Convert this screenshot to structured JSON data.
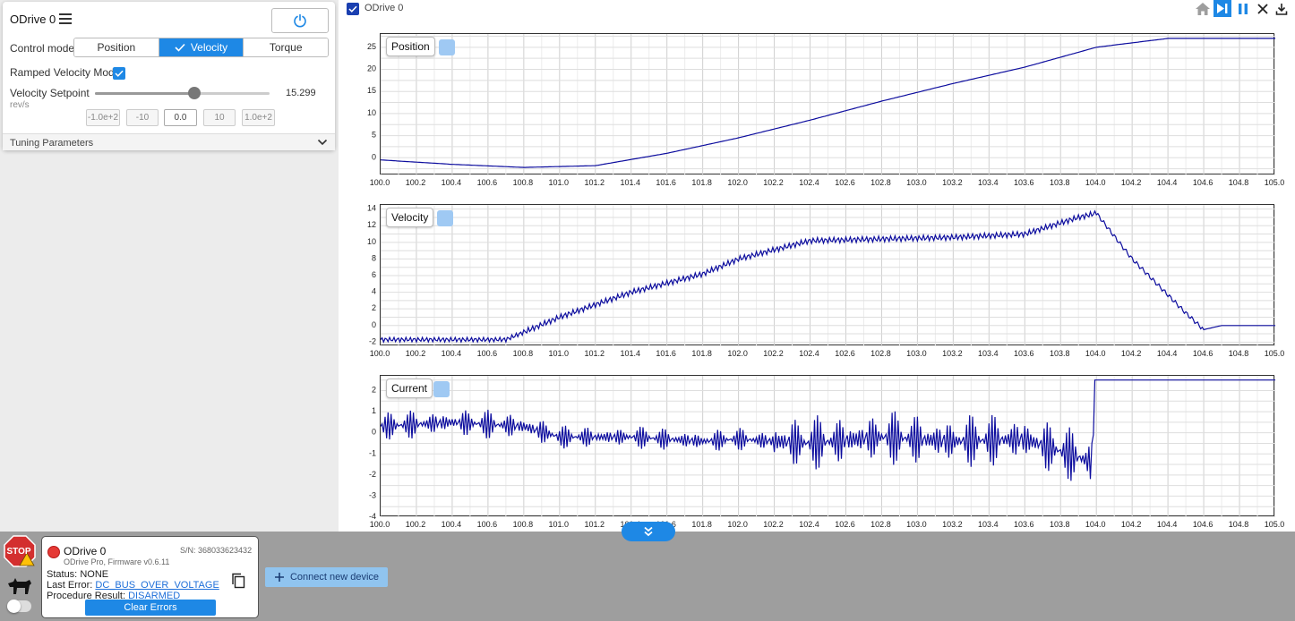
{
  "control_panel": {
    "title": "ODrive 0",
    "control_mode_label": "Control mode",
    "modes": [
      "Position",
      "Velocity",
      "Torque"
    ],
    "active_mode": "Velocity",
    "ramped_label": "Ramped Velocity Mode",
    "ramped_checked": true,
    "setpoint_label": "Velocity Setpoint",
    "setpoint_unit": "rev/s",
    "setpoint_value": "15.299",
    "slider_fraction": 0.57,
    "step_buttons": [
      "-1.0e+2",
      "-10",
      "0.0",
      "10",
      "1.0e+2"
    ],
    "tuning_label": "Tuning Parameters"
  },
  "plot": {
    "title": "ODrive 0",
    "toolbar_icons": [
      "home-icon",
      "skip-end-icon",
      "pause-icon",
      "close-icon",
      "download-icon"
    ],
    "line_color": "#0d0d9e"
  },
  "chart_data": [
    {
      "type": "line",
      "title": "Position",
      "x": [
        100.0,
        100.4,
        100.8,
        101.2,
        101.6,
        102.0,
        102.4,
        102.8,
        103.2,
        103.6,
        104.0,
        104.4,
        104.8,
        105.0
      ],
      "series": [
        {
          "values": [
            -0.5,
            -1.5,
            -2.2,
            -1.8,
            1.0,
            4.5,
            8.5,
            12.8,
            16.8,
            20.5,
            25.0,
            27.0,
            27.0,
            27.0
          ]
        }
      ],
      "xlim": [
        100.0,
        105.0
      ],
      "ylim": [
        -4,
        28
      ],
      "yticks": [
        0,
        5,
        10,
        15,
        20,
        25
      ],
      "xticks": [
        "100.0",
        "100.2",
        "100.4",
        "100.6",
        "100.8",
        "101.0",
        "101.2",
        "101.4",
        "101.6",
        "101.8",
        "102.0",
        "102.2",
        "102.4",
        "102.6",
        "102.8",
        "103.0",
        "103.2",
        "103.4",
        "103.6",
        "103.8",
        "104.0",
        "104.2",
        "104.4",
        "104.6",
        "104.8",
        "105.0"
      ]
    },
    {
      "type": "line",
      "title": "Velocity",
      "x": [
        100.0,
        100.4,
        100.7,
        101.0,
        101.4,
        101.8,
        102.0,
        102.4,
        102.8,
        103.2,
        103.6,
        103.9,
        104.0,
        104.2,
        104.5,
        104.6,
        104.7,
        105.0
      ],
      "series": [
        {
          "values": [
            -1.7,
            -1.7,
            -1.7,
            1.0,
            4.0,
            6.2,
            8.0,
            10.2,
            10.4,
            10.6,
            11.0,
            13.0,
            13.5,
            8.0,
            1.5,
            -0.5,
            0.0,
            0.0
          ]
        }
      ],
      "xlim": [
        100.0,
        105.0
      ],
      "ylim": [
        -2.5,
        14.5
      ],
      "yticks": [
        -2,
        0,
        2,
        4,
        6,
        8,
        10,
        12,
        14
      ],
      "xticks": [
        "100.0",
        "100.2",
        "100.4",
        "100.6",
        "100.8",
        "101.0",
        "101.2",
        "101.4",
        "101.6",
        "101.8",
        "102.0",
        "102.2",
        "102.4",
        "102.6",
        "102.8",
        "103.0",
        "103.2",
        "103.4",
        "103.6",
        "103.8",
        "104.0",
        "104.2",
        "104.4",
        "104.6",
        "104.8",
        "105.0"
      ]
    },
    {
      "type": "line",
      "title": "Current",
      "x": [
        100.0,
        100.4,
        100.8,
        101.0,
        101.4,
        101.8,
        102.0,
        102.4,
        102.8,
        103.2,
        103.6,
        103.98,
        103.99,
        104.0,
        105.0
      ],
      "series": [
        {
          "values": [
            0.3,
            0.5,
            0.3,
            -0.2,
            -0.2,
            -0.4,
            -0.3,
            -0.5,
            -0.2,
            -0.4,
            -0.3,
            -1.4,
            2.5,
            2.5,
            2.5
          ]
        }
      ],
      "xlim": [
        100.0,
        105.0
      ],
      "ylim": [
        -4,
        2.7
      ],
      "yticks": [
        -4,
        -3,
        -2,
        -1,
        0,
        1,
        2
      ],
      "xticks": [
        "100.0",
        "100.2",
        "100.4",
        "100.6",
        "100.8",
        "101.0",
        "101.2",
        "101.4",
        "101.6",
        "101.8",
        "102.0",
        "102.2",
        "102.4",
        "102.6",
        "102.8",
        "103.0",
        "103.2",
        "103.4",
        "103.6",
        "103.8",
        "104.0",
        "104.2",
        "104.4",
        "104.6",
        "104.8",
        "105.0"
      ]
    }
  ],
  "device": {
    "name": "ODrive 0",
    "serial": "S/N: 368033623432",
    "firmware": "ODrive Pro, Firmware v0.6.11",
    "status_label": "Status:",
    "status_value": "NONE",
    "last_error_label": "Last Error:",
    "last_error_value": "DC_BUS_OVER_VOLTAGE",
    "procedure_label": "Procedure Result:",
    "procedure_value": "DISARMED",
    "clear_errors_label": "Clear Errors",
    "status_color": "#e53935"
  },
  "bottom": {
    "stop_label": "STOP",
    "connect_label": "Connect new device"
  }
}
